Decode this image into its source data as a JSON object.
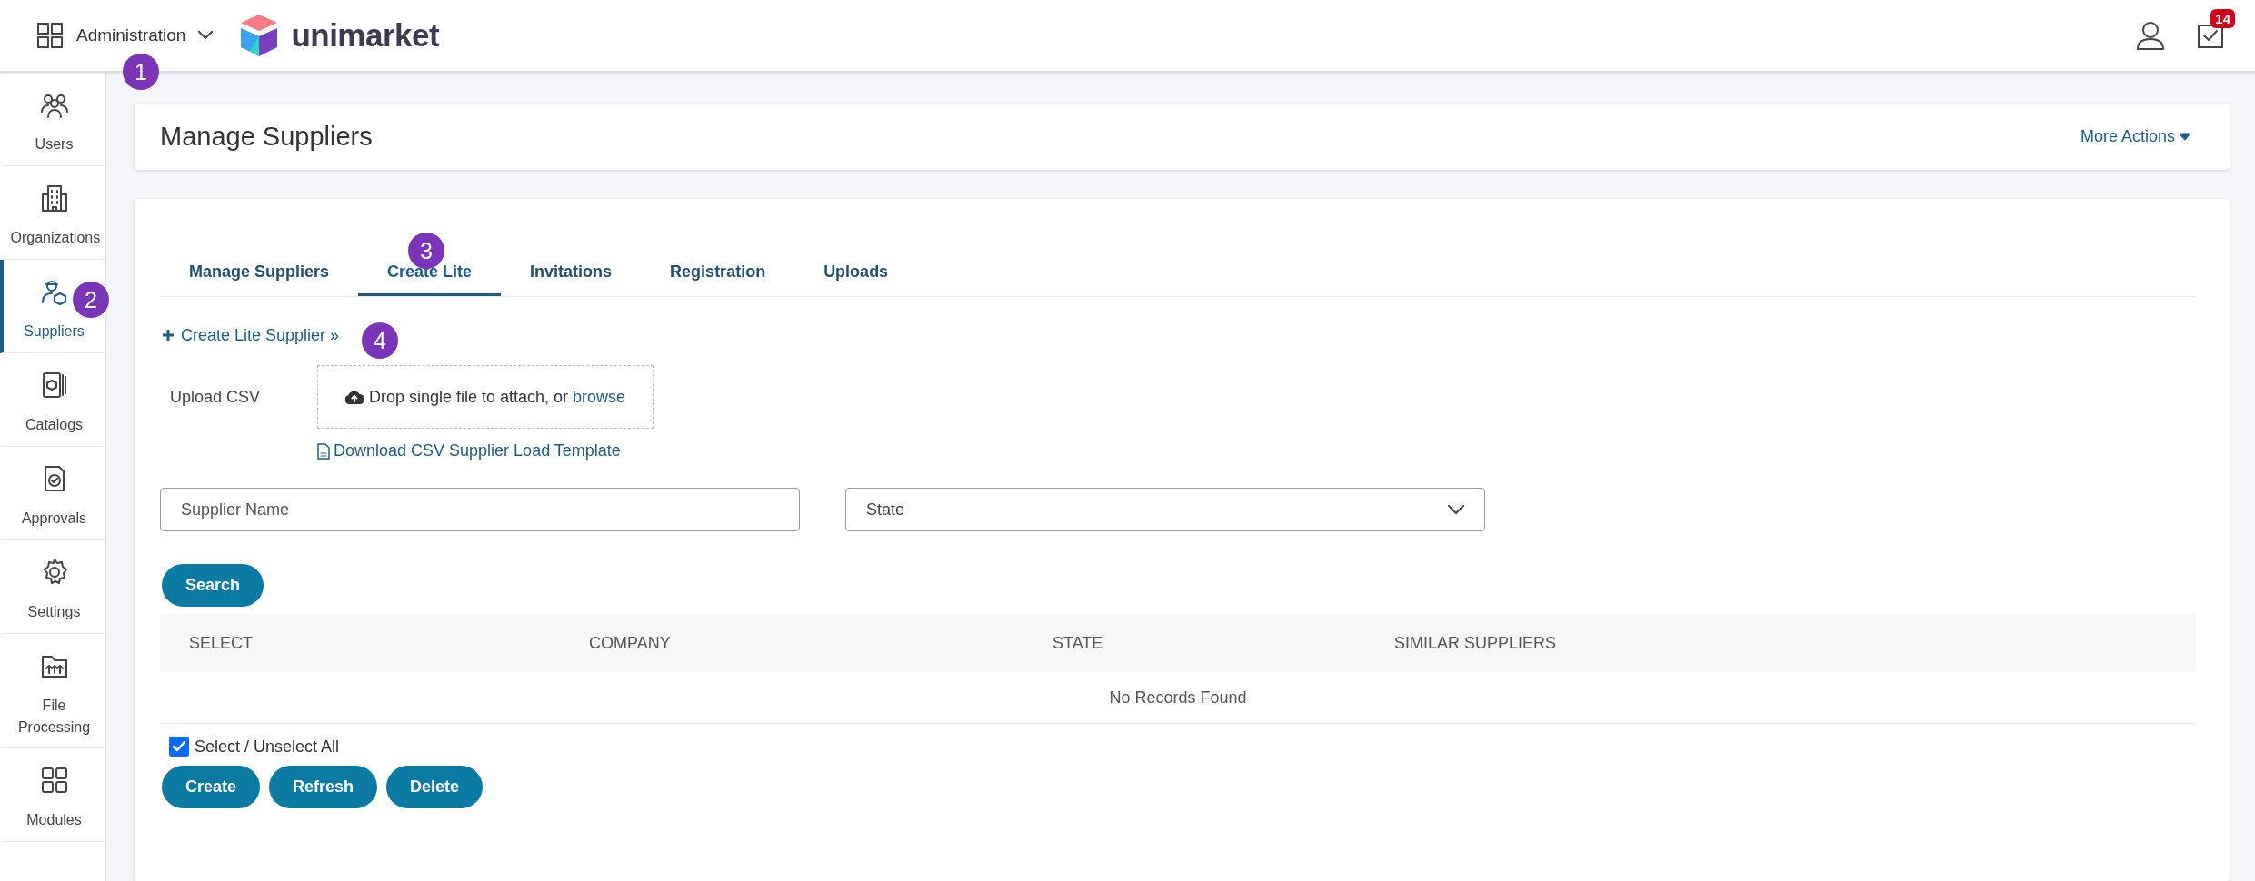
{
  "header": {
    "app_switcher": "Administration",
    "logo": "unimarket",
    "notifications_count": "14"
  },
  "sidebar": {
    "items": [
      {
        "label": "Users",
        "kind": "users",
        "selected": false
      },
      {
        "label": "Organizations",
        "kind": "building",
        "selected": false
      },
      {
        "label": "Suppliers",
        "kind": "supplier",
        "selected": true
      },
      {
        "label": "Catalogs",
        "kind": "catalog",
        "selected": false
      },
      {
        "label": "Approvals",
        "kind": "approval",
        "selected": false
      },
      {
        "label": "Settings",
        "kind": "gear",
        "selected": false
      },
      {
        "label": "File Processing",
        "kind": "folder",
        "selected": false
      },
      {
        "label": "Modules",
        "kind": "modules",
        "selected": false
      }
    ]
  },
  "page": {
    "title": "Manage Suppliers",
    "more_actions": "More Actions"
  },
  "tabs": [
    {
      "label": "Manage Suppliers",
      "selected": false
    },
    {
      "label": "Create Lite",
      "selected": true
    },
    {
      "label": "Invitations",
      "selected": false
    },
    {
      "label": "Registration",
      "selected": false
    },
    {
      "label": "Uploads",
      "selected": false
    }
  ],
  "create_link": "Create Lite Supplier »",
  "upload": {
    "label": "Upload CSV",
    "drop_text": "Drop single file to attach, or",
    "browse": "browse",
    "template_link": "Download CSV Supplier Load Template"
  },
  "filters": {
    "supplier_name": {
      "placeholder": "Supplier Name"
    },
    "state": {
      "placeholder": "State"
    }
  },
  "search_button": "Search",
  "table": {
    "columns": [
      "SELECT",
      "COMPANY",
      "STATE",
      "SIMILAR SUPPLIERS"
    ],
    "empty_text": "No Records Found"
  },
  "select_all": {
    "label": "Select / Unselect All",
    "checked": true
  },
  "buttons": [
    "Create",
    "Refresh",
    "Delete"
  ],
  "annotations": [
    "1",
    "2",
    "3",
    "4"
  ]
}
